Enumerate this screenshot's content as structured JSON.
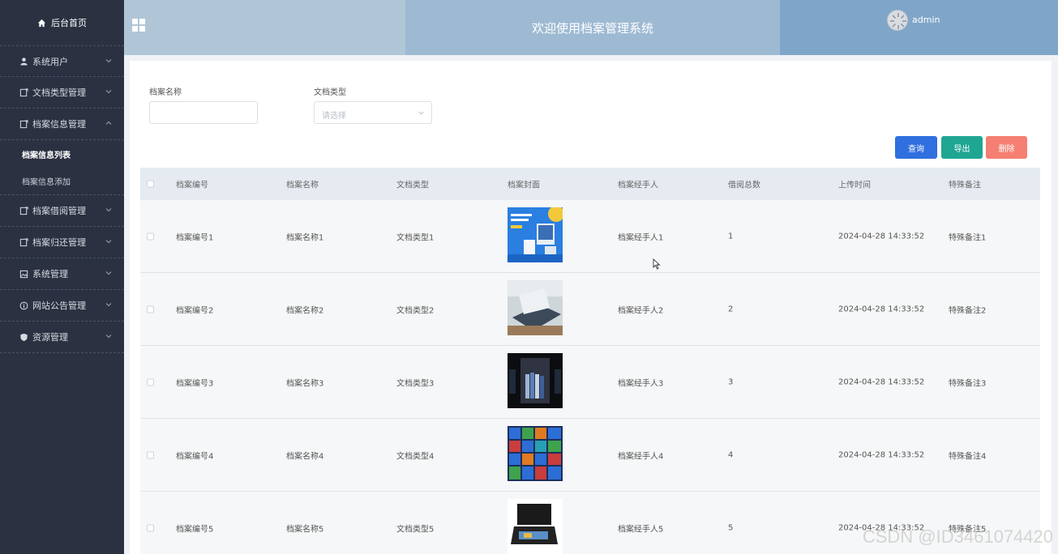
{
  "sidebar": {
    "home_label": "后台首页",
    "items": [
      {
        "label": "系统用户",
        "icon": "user-icon"
      },
      {
        "label": "文档类型管理",
        "icon": "document-icon"
      },
      {
        "label": "档案信息管理",
        "icon": "document-icon",
        "expanded": true
      },
      {
        "label": "档案借阅管理",
        "icon": "document-icon"
      },
      {
        "label": "档案归还管理",
        "icon": "document-icon"
      },
      {
        "label": "系统管理",
        "icon": "image-icon"
      },
      {
        "label": "网站公告管理",
        "icon": "info-icon"
      },
      {
        "label": "资源管理",
        "icon": "shield-icon"
      }
    ],
    "sub_items": [
      {
        "label": "档案信息列表",
        "active": true
      },
      {
        "label": "档案信息添加",
        "active": false
      }
    ]
  },
  "header": {
    "title": "欢迎使用档案管理系统",
    "user": "admin"
  },
  "filters": {
    "name_label": "档案名称",
    "name_value": "",
    "type_label": "文档类型",
    "type_placeholder": "请选择"
  },
  "buttons": {
    "search": "查询",
    "export": "导出",
    "delete": "删除"
  },
  "colors": {
    "search": "#2f6fe0",
    "export": "#1fa693",
    "delete": "#f47f72"
  },
  "table": {
    "columns": [
      "档案编号",
      "档案名称",
      "文档类型",
      "档案封面",
      "档案经手人",
      "借阅总数",
      "上传时间",
      "特殊备注"
    ],
    "rows": [
      {
        "no": "档案编号1",
        "name": "档案名称1",
        "type": "文档类型1",
        "cover": "blue-devices",
        "handler": "档案经手人1",
        "count": "1",
        "time": "2024-04-28 14:33:52",
        "note": "特殊备注1"
      },
      {
        "no": "档案编号2",
        "name": "档案名称2",
        "type": "文档类型2",
        "cover": "laptop-desk",
        "handler": "档案经手人2",
        "count": "2",
        "time": "2024-04-28 14:33:52",
        "note": "特殊备注2"
      },
      {
        "no": "档案编号3",
        "name": "档案名称3",
        "type": "文档类型3",
        "cover": "book-stack",
        "handler": "档案经手人3",
        "count": "3",
        "time": "2024-04-28 14:33:52",
        "note": "特殊备注3"
      },
      {
        "no": "档案编号4",
        "name": "档案名称4",
        "type": "文档类型4",
        "cover": "tile-grid",
        "handler": "档案经手人4",
        "count": "4",
        "time": "2024-04-28 14:33:52",
        "note": "特殊备注4"
      },
      {
        "no": "档案编号5",
        "name": "档案名称5",
        "type": "文档类型5",
        "cover": "scanner",
        "handler": "档案经手人5",
        "count": "5",
        "time": "2024-04-28 14:33:52",
        "note": "特殊备注5"
      }
    ]
  },
  "watermark": "CSDN @ID3461074420"
}
